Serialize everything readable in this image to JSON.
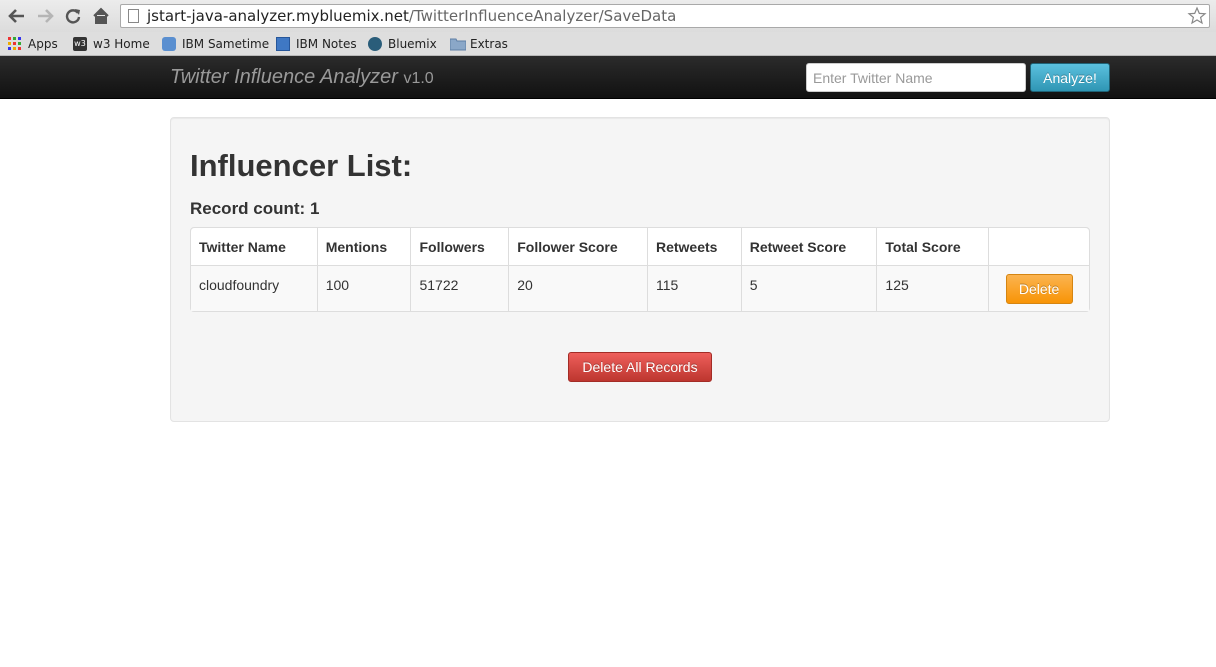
{
  "browser": {
    "url_host": "jstart-java-analyzer.mybluemix.net",
    "url_path": "/TwitterInfluenceAnalyzer/SaveData",
    "bookmarks": [
      {
        "label": "Apps",
        "icon": "apps-grid-icon"
      },
      {
        "label": "w3 Home",
        "icon": "w3-icon"
      },
      {
        "label": "IBM Sametime",
        "icon": "sametime-icon"
      },
      {
        "label": "IBM Notes",
        "icon": "notes-icon"
      },
      {
        "label": "Bluemix",
        "icon": "bluemix-icon"
      },
      {
        "label": "Extras",
        "icon": "folder-icon"
      }
    ]
  },
  "navbar": {
    "brand": "Twitter Influence Analyzer",
    "version": "v1.0",
    "search_placeholder": "Enter Twitter Name",
    "analyze_label": "Analyze!"
  },
  "main": {
    "title": "Influencer List:",
    "record_count": "Record count: 1",
    "columns": [
      "Twitter Name",
      "Mentions",
      "Followers",
      "Follower Score",
      "Retweets",
      "Retweet Score",
      "Total Score",
      ""
    ],
    "rows": [
      {
        "twitter_name": "cloudfoundry",
        "mentions": "100",
        "followers": "51722",
        "follower_score": "20",
        "retweets": "115",
        "retweet_score": "5",
        "total_score": "125",
        "delete_label": "Delete"
      }
    ],
    "delete_all_label": "Delete All Records"
  },
  "colors": {
    "navbar_bg": "#1b1b1b",
    "analyze_btn": "#49afcd",
    "delete_btn": "#faa732",
    "delete_all_btn": "#da4f49"
  }
}
